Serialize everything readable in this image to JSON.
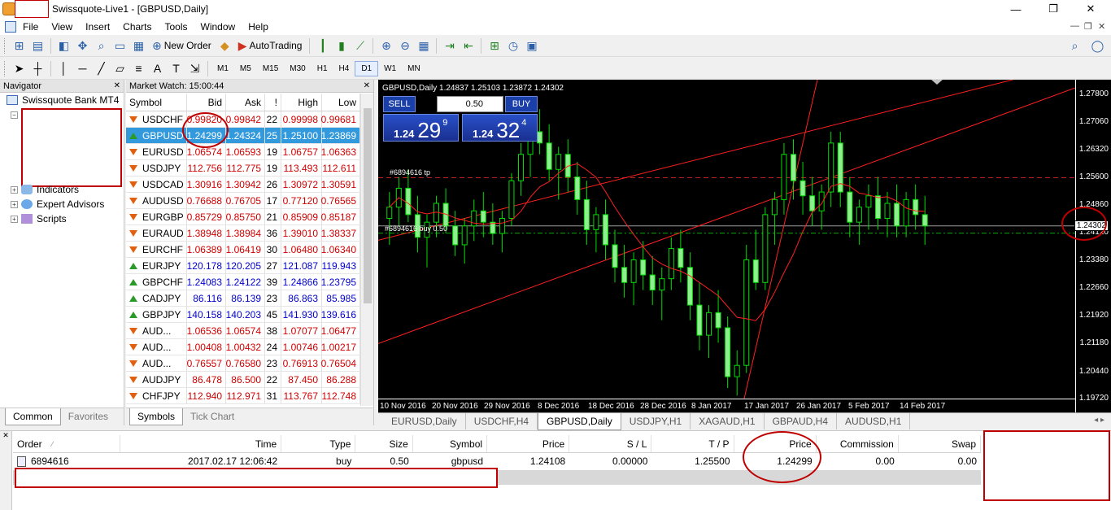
{
  "window": {
    "title": "Swissquote-Live1 - [GBPUSD,Daily]",
    "controls": {
      "minimize": "—",
      "maximize": "❐",
      "close": "✕"
    }
  },
  "menu": [
    "File",
    "View",
    "Insert",
    "Charts",
    "Tools",
    "Window",
    "Help"
  ],
  "mdi_controls": {
    "minimize": "—",
    "restore": "❐",
    "close": "✕"
  },
  "toolbar": {
    "new_order": "New Order",
    "autotrading": "AutoTrading",
    "timeframes": [
      "M1",
      "M5",
      "M15",
      "M30",
      "H1",
      "H4",
      "D1",
      "W1",
      "MN"
    ],
    "active_timeframe": "D1"
  },
  "navigator": {
    "title": "Navigator",
    "root": "Swissquote Bank MT4",
    "items": [
      "Indicators",
      "Expert Advisors",
      "Scripts"
    ],
    "tabs": [
      "Common",
      "Favorites"
    ]
  },
  "market_watch": {
    "title": "Market Watch: 15:00:44",
    "columns": [
      "Symbol",
      "Bid",
      "Ask",
      "!",
      "High",
      "Low"
    ],
    "rows": [
      {
        "symbol": "USDCHF",
        "bid": "0.99820",
        "ask": "0.99842",
        "spread": "22",
        "high": "0.99998",
        "low": "0.99681",
        "dir": "down",
        "color": "red"
      },
      {
        "symbol": "GBPUSD",
        "bid": "1.24299",
        "ask": "1.24324",
        "spread": "25",
        "high": "1.25100",
        "low": "1.23869",
        "dir": "up",
        "color": "blue",
        "selected": true
      },
      {
        "symbol": "EURUSD",
        "bid": "1.06574",
        "ask": "1.06593",
        "spread": "19",
        "high": "1.06757",
        "low": "1.06363",
        "dir": "down",
        "color": "red"
      },
      {
        "symbol": "USDJPY",
        "bid": "112.756",
        "ask": "112.775",
        "spread": "19",
        "high": "113.493",
        "low": "112.611",
        "dir": "down",
        "color": "red"
      },
      {
        "symbol": "USDCAD",
        "bid": "1.30916",
        "ask": "1.30942",
        "spread": "26",
        "high": "1.30972",
        "low": "1.30591",
        "dir": "down",
        "color": "red"
      },
      {
        "symbol": "AUDUSD",
        "bid": "0.76688",
        "ask": "0.76705",
        "spread": "17",
        "high": "0.77120",
        "low": "0.76565",
        "dir": "down",
        "color": "red"
      },
      {
        "symbol": "EURGBP",
        "bid": "0.85729",
        "ask": "0.85750",
        "spread": "21",
        "high": "0.85909",
        "low": "0.85187",
        "dir": "down",
        "color": "red"
      },
      {
        "symbol": "EURAUD",
        "bid": "1.38948",
        "ask": "1.38984",
        "spread": "36",
        "high": "1.39010",
        "low": "1.38337",
        "dir": "down",
        "color": "red"
      },
      {
        "symbol": "EURCHF",
        "bid": "1.06389",
        "ask": "1.06419",
        "spread": "30",
        "high": "1.06480",
        "low": "1.06340",
        "dir": "down",
        "color": "red"
      },
      {
        "symbol": "EURJPY",
        "bid": "120.178",
        "ask": "120.205",
        "spread": "27",
        "high": "121.087",
        "low": "119.943",
        "dir": "up",
        "color": "blue"
      },
      {
        "symbol": "GBPCHF",
        "bid": "1.24083",
        "ask": "1.24122",
        "spread": "39",
        "high": "1.24866",
        "low": "1.23795",
        "dir": "up",
        "color": "blue"
      },
      {
        "symbol": "CADJPY",
        "bid": "86.116",
        "ask": "86.139",
        "spread": "23",
        "high": "86.863",
        "low": "85.985",
        "dir": "up",
        "color": "blue"
      },
      {
        "symbol": "GBPJPY",
        "bid": "140.158",
        "ask": "140.203",
        "spread": "45",
        "high": "141.930",
        "low": "139.616",
        "dir": "up",
        "color": "blue"
      },
      {
        "symbol": "AUD...",
        "bid": "1.06536",
        "ask": "1.06574",
        "spread": "38",
        "high": "1.07077",
        "low": "1.06477",
        "dir": "down",
        "color": "red"
      },
      {
        "symbol": "AUD...",
        "bid": "1.00408",
        "ask": "1.00432",
        "spread": "24",
        "high": "1.00746",
        "low": "1.00217",
        "dir": "down",
        "color": "red"
      },
      {
        "symbol": "AUD...",
        "bid": "0.76557",
        "ask": "0.76580",
        "spread": "23",
        "high": "0.76913",
        "low": "0.76504",
        "dir": "down",
        "color": "red"
      },
      {
        "symbol": "AUDJPY",
        "bid": "86.478",
        "ask": "86.500",
        "spread": "22",
        "high": "87.450",
        "low": "86.288",
        "dir": "down",
        "color": "red"
      },
      {
        "symbol": "CHFJPY",
        "bid": "112.940",
        "ask": "112.971",
        "spread": "31",
        "high": "113.767",
        "low": "112.748",
        "dir": "down",
        "color": "red"
      }
    ],
    "tabs": [
      "Symbols",
      "Tick Chart"
    ]
  },
  "chart": {
    "header": "GBPUSD,Daily  1.24837 1.25103 1.23872 1.24302",
    "trade": {
      "sell": "SELL",
      "buy": "BUY",
      "lot": "0.50",
      "sell_small": "1.24",
      "sell_big": "29",
      "sell_sup": "9",
      "buy_small": "1.24",
      "buy_big": "32",
      "buy_sup": "4"
    },
    "tp_label": "#6894616 tp",
    "buy_label": "#6894616 buy 0.50",
    "y_ticks": [
      "1.27800",
      "1.27060",
      "1.26320",
      "1.25600",
      "1.24860",
      "1.24120",
      "1.23380",
      "1.22660",
      "1.21920",
      "1.21180",
      "1.20440",
      "1.19720"
    ],
    "current_price": "1.24302",
    "x_ticks": [
      "10 Nov 2016",
      "20 Nov 2016",
      "29 Nov 2016",
      "8 Dec 2016",
      "18 Dec 2016",
      "28 Dec 2016",
      "8 Jan 2017",
      "17 Jan 2017",
      "26 Jan 2017",
      "5 Feb 2017",
      "14 Feb 2017"
    ],
    "tabs": [
      "EURUSD,Daily",
      "USDCHF,H4",
      "GBPUSD,Daily",
      "USDJPY,H1",
      "XAGAUD,H1",
      "GBPAUD,H4",
      "AUDUSD,H1"
    ],
    "active_tab": "GBPUSD,Daily"
  },
  "chart_data": {
    "type": "candlestick",
    "title": "GBPUSD,Daily",
    "ylim": [
      1.1972,
      1.2818
    ],
    "tp_level": 1.2558,
    "entry_level": 1.24108,
    "current": 1.24302,
    "candles": [
      [
        1.245,
        1.252,
        1.238,
        1.248
      ],
      [
        1.248,
        1.256,
        1.243,
        1.253
      ],
      [
        1.253,
        1.258,
        1.244,
        1.246
      ],
      [
        1.246,
        1.251,
        1.236,
        1.24
      ],
      [
        1.24,
        1.246,
        1.232,
        1.244
      ],
      [
        1.244,
        1.251,
        1.24,
        1.249
      ],
      [
        1.249,
        1.253,
        1.241,
        1.243
      ],
      [
        1.243,
        1.247,
        1.235,
        1.238
      ],
      [
        1.238,
        1.245,
        1.233,
        1.243
      ],
      [
        1.243,
        1.25,
        1.239,
        1.247
      ],
      [
        1.247,
        1.252,
        1.24,
        1.244
      ],
      [
        1.244,
        1.249,
        1.238,
        1.241
      ],
      [
        1.241,
        1.247,
        1.236,
        1.245
      ],
      [
        1.245,
        1.257,
        1.243,
        1.255
      ],
      [
        1.255,
        1.265,
        1.251,
        1.262
      ],
      [
        1.262,
        1.272,
        1.256,
        1.268
      ],
      [
        1.268,
        1.274,
        1.262,
        1.265
      ],
      [
        1.265,
        1.27,
        1.255,
        1.258
      ],
      [
        1.258,
        1.264,
        1.25,
        1.262
      ],
      [
        1.262,
        1.266,
        1.252,
        1.256
      ],
      [
        1.256,
        1.26,
        1.246,
        1.25
      ],
      [
        1.25,
        1.255,
        1.238,
        1.242
      ],
      [
        1.242,
        1.248,
        1.236,
        1.246
      ],
      [
        1.246,
        1.25,
        1.234,
        1.238
      ],
      [
        1.238,
        1.242,
        1.228,
        1.232
      ],
      [
        1.232,
        1.238,
        1.224,
        1.228
      ],
      [
        1.228,
        1.236,
        1.222,
        1.234
      ],
      [
        1.234,
        1.239,
        1.226,
        1.23
      ],
      [
        1.23,
        1.235,
        1.222,
        1.226
      ],
      [
        1.226,
        1.232,
        1.218,
        1.229
      ],
      [
        1.229,
        1.24,
        1.226,
        1.237
      ],
      [
        1.237,
        1.242,
        1.228,
        1.232
      ],
      [
        1.232,
        1.236,
        1.218,
        1.222
      ],
      [
        1.222,
        1.228,
        1.21,
        1.214
      ],
      [
        1.214,
        1.222,
        1.208,
        1.22
      ],
      [
        1.22,
        1.226,
        1.212,
        1.216
      ],
      [
        1.216,
        1.219,
        1.2,
        1.203
      ],
      [
        1.203,
        1.21,
        1.198,
        1.206
      ],
      [
        1.206,
        1.238,
        1.204,
        1.234
      ],
      [
        1.234,
        1.242,
        1.226,
        1.228
      ],
      [
        1.228,
        1.248,
        1.226,
        1.246
      ],
      [
        1.246,
        1.252,
        1.238,
        1.25
      ],
      [
        1.25,
        1.265,
        1.246,
        1.262
      ],
      [
        1.262,
        1.266,
        1.25,
        1.255
      ],
      [
        1.255,
        1.26,
        1.246,
        1.251
      ],
      [
        1.251,
        1.256,
        1.243,
        1.247
      ],
      [
        1.247,
        1.254,
        1.242,
        1.252
      ],
      [
        1.252,
        1.268,
        1.248,
        1.265
      ],
      [
        1.265,
        1.268,
        1.248,
        1.252
      ],
      [
        1.252,
        1.256,
        1.24,
        1.244
      ],
      [
        1.244,
        1.25,
        1.238,
        1.248
      ],
      [
        1.248,
        1.254,
        1.242,
        1.251
      ],
      [
        1.251,
        1.256,
        1.242,
        1.245
      ],
      [
        1.245,
        1.252,
        1.24,
        1.249
      ],
      [
        1.249,
        1.254,
        1.24,
        1.243
      ],
      [
        1.243,
        1.252,
        1.24,
        1.25
      ],
      [
        1.25,
        1.254,
        1.242,
        1.246
      ],
      [
        1.246,
        1.251,
        1.238,
        1.243
      ]
    ]
  },
  "terminal": {
    "columns": [
      "Order",
      "Time",
      "Type",
      "Size",
      "Symbol",
      "Price",
      "S / L",
      "T / P",
      "Price",
      "Commission",
      "Swap"
    ],
    "row": {
      "order": "6894616",
      "time": "2017.02.17 12:06:42",
      "type": "buy",
      "size": "0.50",
      "symbol": "gbpusd",
      "price": "1.24108",
      "sl": "0.00000",
      "tp": "1.25500",
      "cur_price": "1.24299",
      "commission": "0.00",
      "swap": "0.00"
    }
  },
  "colors": {
    "bull": "#90ee90",
    "bear": "#00cc00",
    "ma": "#ff2020",
    "trend": "#ff0000",
    "highlight": "#c00000"
  }
}
